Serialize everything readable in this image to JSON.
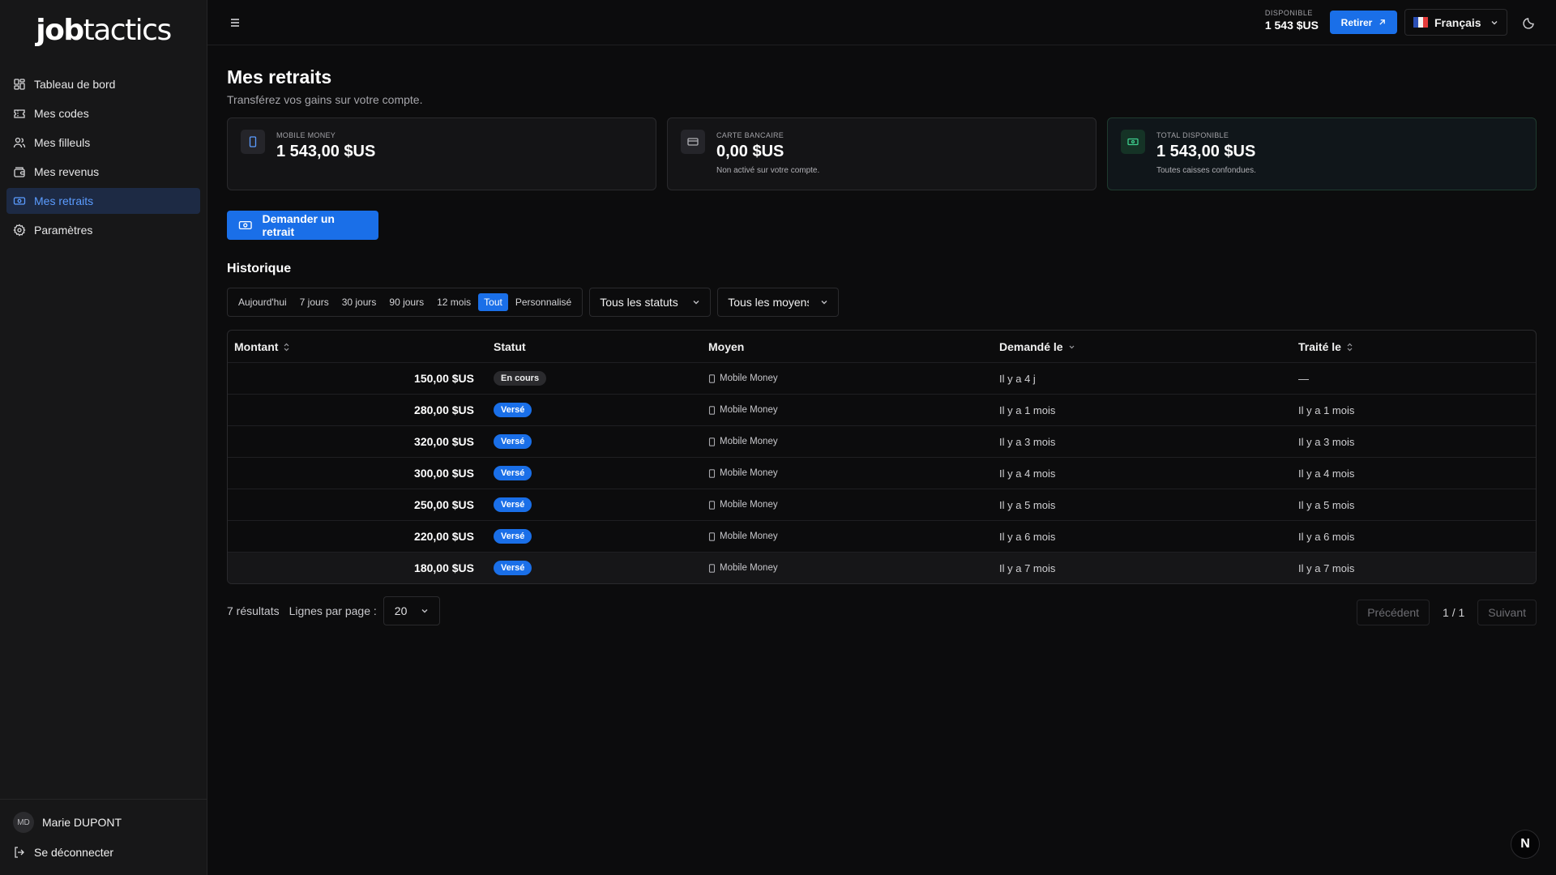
{
  "brand": {
    "logo_bold": "job",
    "logo_thin": "tactics"
  },
  "sidebar": {
    "items": [
      {
        "label": "Tableau de bord",
        "icon": "dashboard-icon"
      },
      {
        "label": "Mes codes",
        "icon": "ticket-icon"
      },
      {
        "label": "Mes filleuls",
        "icon": "users-icon"
      },
      {
        "label": "Mes revenus",
        "icon": "wallet-icon"
      },
      {
        "label": "Mes retraits",
        "icon": "banknote-icon",
        "active": true
      },
      {
        "label": "Paramètres",
        "icon": "gear-icon"
      }
    ],
    "user": {
      "initials": "MD",
      "name": "Marie DUPONT"
    },
    "logout_label": "Se déconnecter"
  },
  "topbar": {
    "available_label": "DISPONIBLE",
    "available_value": "1 543 $US",
    "withdraw_label": "Retirer",
    "language": "Français"
  },
  "page": {
    "title": "Mes retraits",
    "subtitle": "Transférez vos gains sur votre compte."
  },
  "cards": [
    {
      "label": "MOBILE MONEY",
      "value": "1 543,00 $US",
      "note": "",
      "icon": "phone-icon"
    },
    {
      "label": "CARTE BANCAIRE",
      "value": "0,00 $US",
      "note": "Non activé sur votre compte.",
      "icon": "credit-card-icon"
    },
    {
      "label": "TOTAL DISPONIBLE",
      "value": "1 543,00 $US",
      "note": "Toutes caisses confondues.",
      "icon": "banknote-icon"
    }
  ],
  "request_button": "Demander un retrait",
  "history": {
    "title": "Historique",
    "periods": [
      "Aujourd'hui",
      "7 jours",
      "30 jours",
      "90 jours",
      "12 mois",
      "Tout",
      "Personnalisé"
    ],
    "active_period": "Tout",
    "status_filter": "Tous les statuts",
    "method_filter": "Tous les moyens"
  },
  "table": {
    "headers": {
      "amount": "Montant",
      "status": "Statut",
      "method": "Moyen",
      "requested": "Demandé le",
      "processed": "Traité le"
    },
    "rows": [
      {
        "amount": "150,00 $US",
        "status": "En cours",
        "status_type": "encours",
        "method": "Mobile Money",
        "requested": "Il y a 4 j",
        "processed": "—"
      },
      {
        "amount": "280,00 $US",
        "status": "Versé",
        "status_type": "verse",
        "method": "Mobile Money",
        "requested": "Il y a 1 mois",
        "processed": "Il y a 1 mois"
      },
      {
        "amount": "320,00 $US",
        "status": "Versé",
        "status_type": "verse",
        "method": "Mobile Money",
        "requested": "Il y a 3 mois",
        "processed": "Il y a 3 mois"
      },
      {
        "amount": "300,00 $US",
        "status": "Versé",
        "status_type": "verse",
        "method": "Mobile Money",
        "requested": "Il y a 4 mois",
        "processed": "Il y a 4 mois"
      },
      {
        "amount": "250,00 $US",
        "status": "Versé",
        "status_type": "verse",
        "method": "Mobile Money",
        "requested": "Il y a 5 mois",
        "processed": "Il y a 5 mois"
      },
      {
        "amount": "220,00 $US",
        "status": "Versé",
        "status_type": "verse",
        "method": "Mobile Money",
        "requested": "Il y a 6 mois",
        "processed": "Il y a 6 mois"
      },
      {
        "amount": "180,00 $US",
        "status": "Versé",
        "status_type": "verse",
        "method": "Mobile Money",
        "requested": "Il y a 7 mois",
        "processed": "Il y a 7 mois"
      }
    ]
  },
  "pagination": {
    "results": "7 résultats",
    "rows_label": "Lignes par page :",
    "rows_value": "20",
    "prev": "Précédent",
    "indicator": "1 / 1",
    "next": "Suivant"
  },
  "corner_badge": "N",
  "colors": {
    "accent": "#1a6fe8",
    "background": "#0c0c0d",
    "sidebar": "#171718"
  }
}
